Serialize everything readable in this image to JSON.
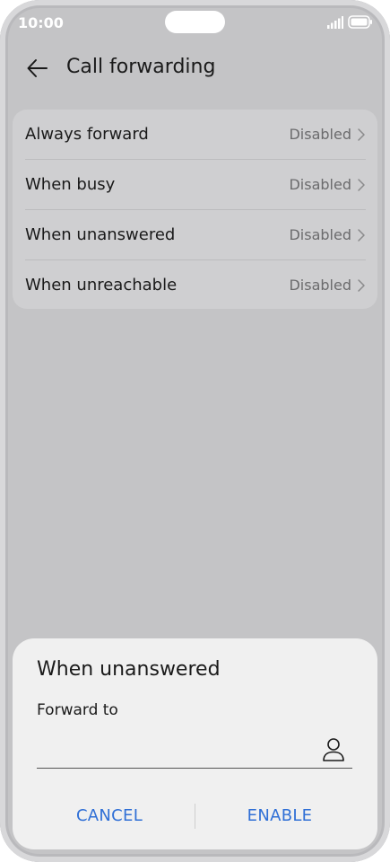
{
  "status_bar": {
    "time": "10:00"
  },
  "header": {
    "title": "Call forwarding",
    "back_icon": "arrow-left-icon"
  },
  "forwarding_options": [
    {
      "label": "Always forward",
      "value": "Disabled"
    },
    {
      "label": "When busy",
      "value": "Disabled"
    },
    {
      "label": "When unanswered",
      "value": "Disabled"
    },
    {
      "label": "When unreachable",
      "value": "Disabled"
    }
  ],
  "dialog": {
    "title": "When unanswered",
    "field_label": "Forward to",
    "field_value": "",
    "contact_icon": "person-icon",
    "cancel_label": "CANCEL",
    "enable_label": "ENABLE"
  },
  "colors": {
    "accent": "#2f6fd6",
    "scrim": "#c4c4c6",
    "sheet_background": "#f0f0f0"
  }
}
